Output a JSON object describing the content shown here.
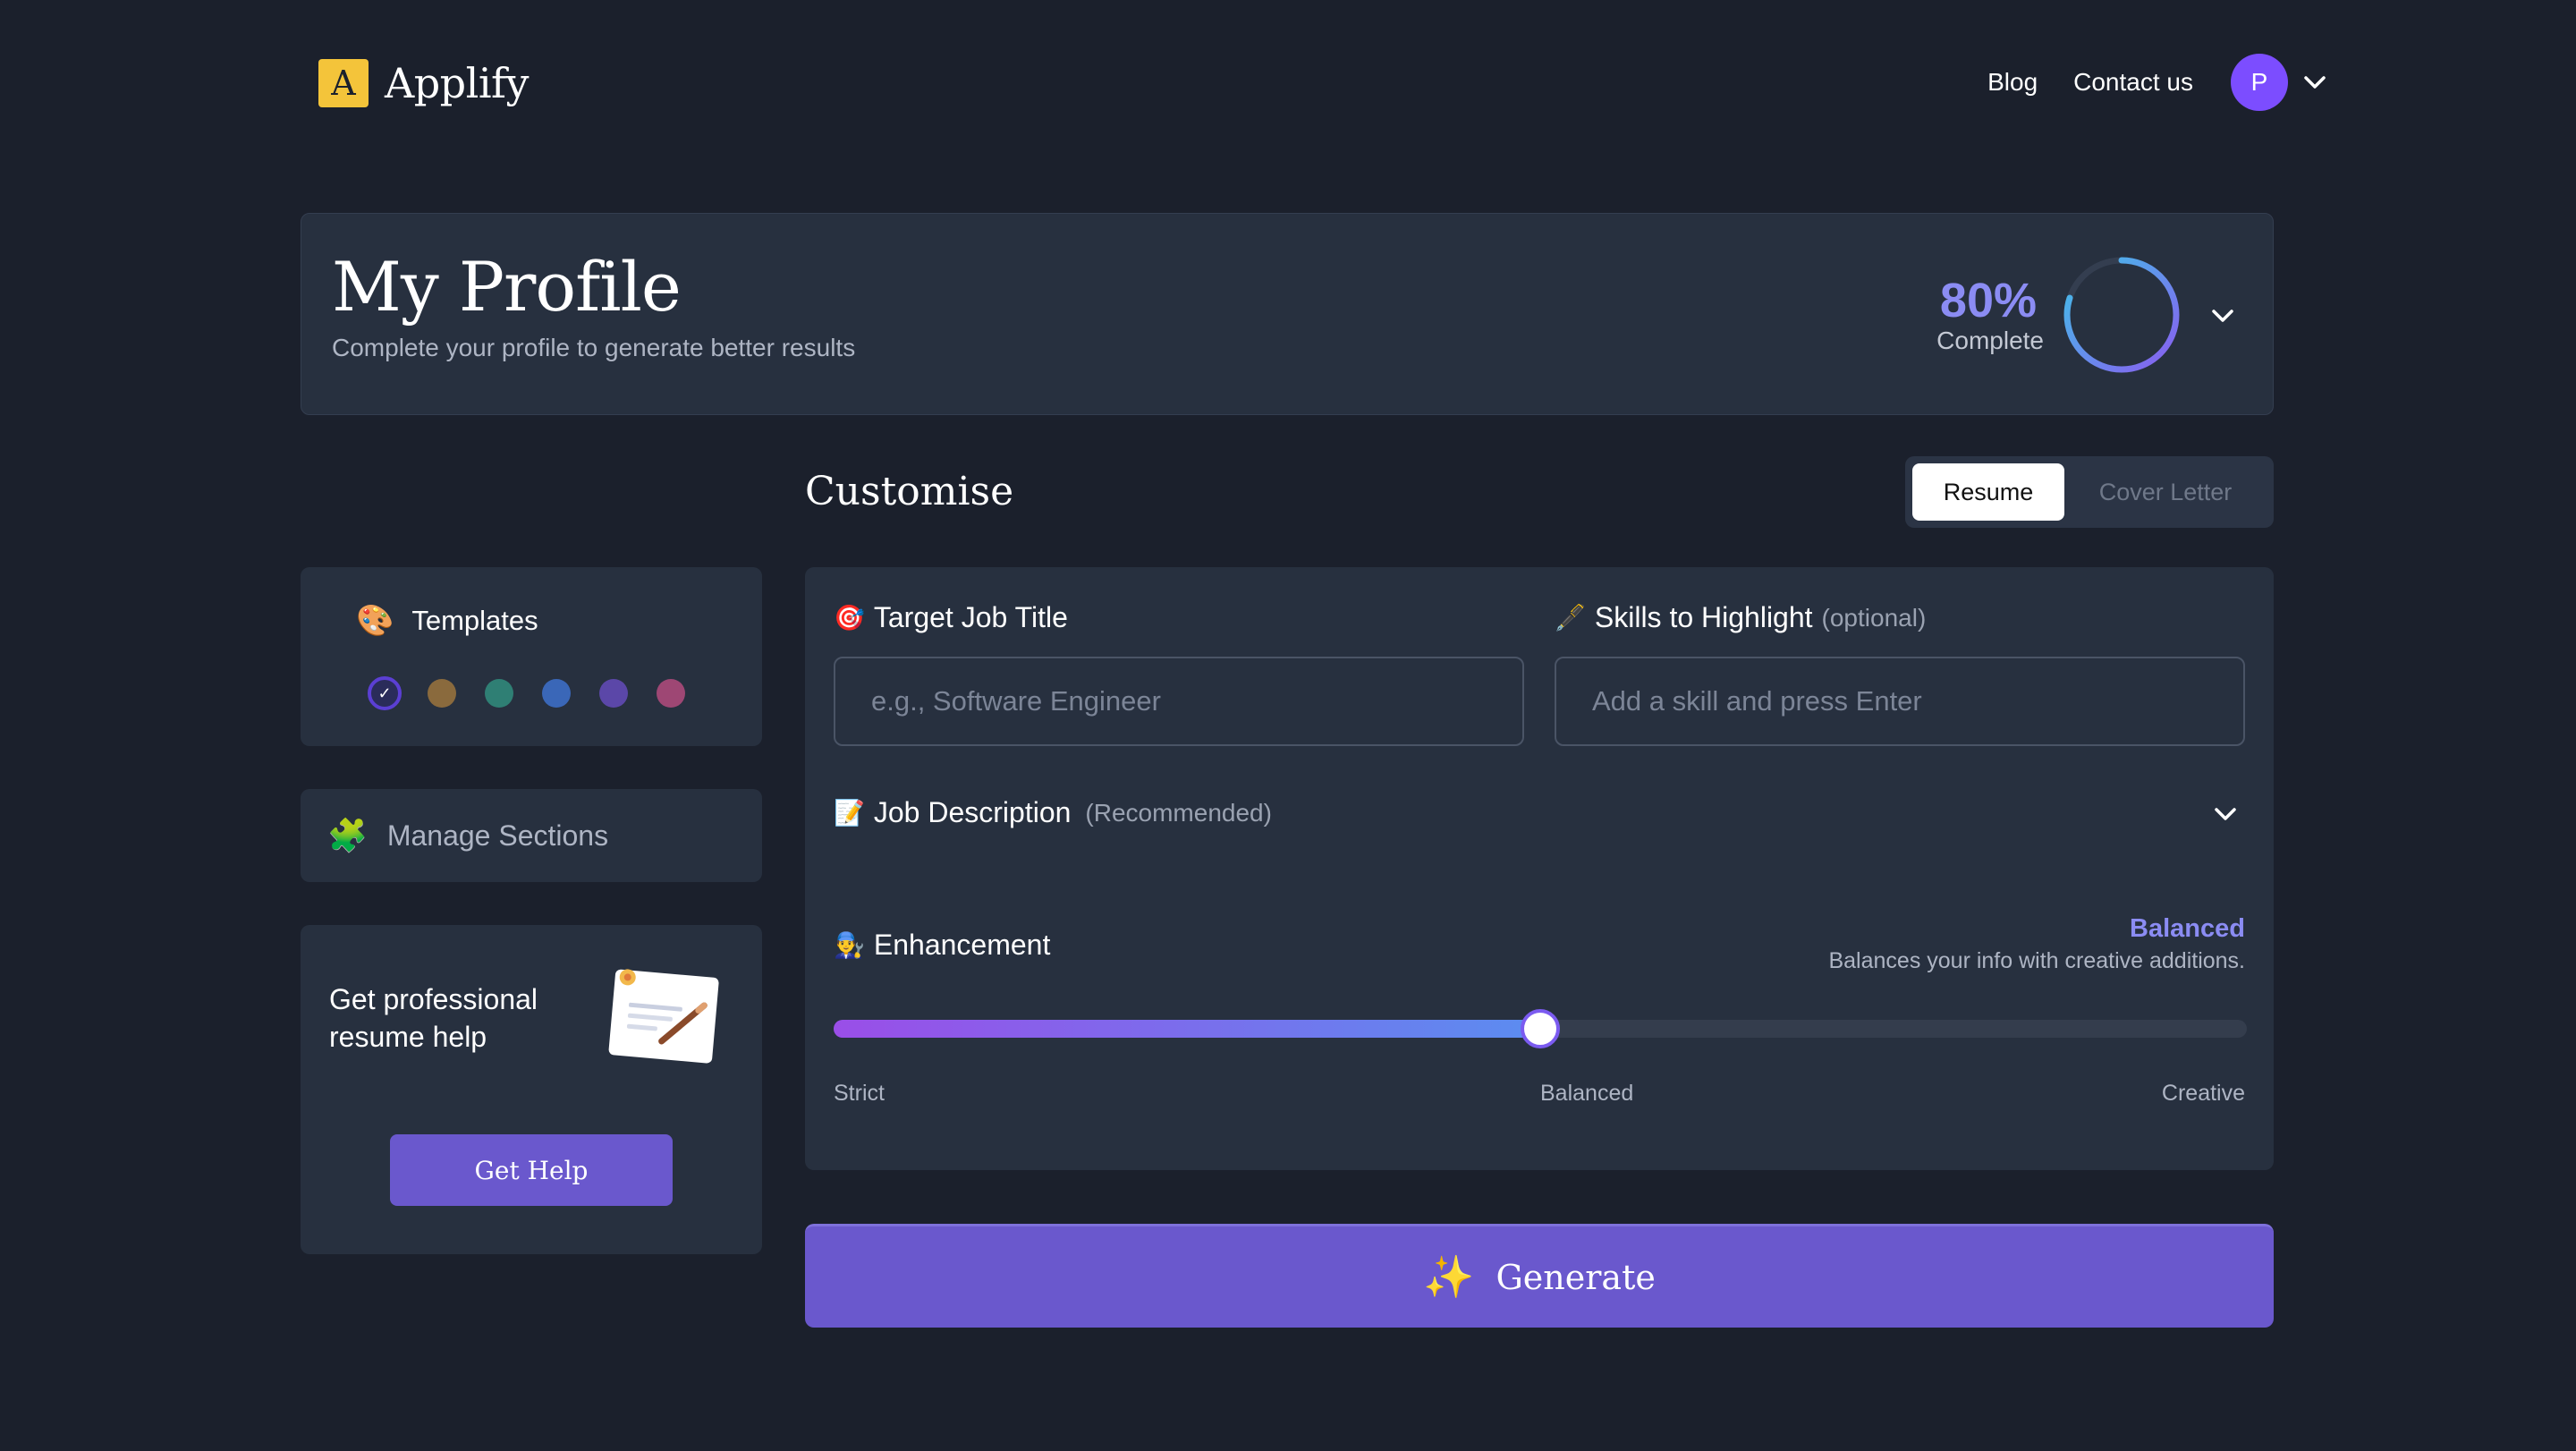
{
  "header": {
    "logo_letter": "A",
    "app_name": "Applify",
    "nav": {
      "blog": "Blog",
      "contact": "Contact us"
    },
    "avatar_initial": "P"
  },
  "profile": {
    "title": "My Profile",
    "subtitle": "Complete your profile to generate better results",
    "progress_percent": 80,
    "progress_text": "80%",
    "progress_label": "Complete"
  },
  "customise": {
    "title": "Customise",
    "tabs": [
      {
        "label": "Resume",
        "active": true
      },
      {
        "label": "Cover Letter",
        "active": false
      }
    ]
  },
  "sidebar": {
    "templates": {
      "emoji": "🎨",
      "label": "Templates",
      "colors": [
        "#5b3fd3",
        "#8a6a3d",
        "#2f7f74",
        "#3a67b8",
        "#5b47a8",
        "#9e4774"
      ],
      "selected_index": 0,
      "selected_mark": "✓"
    },
    "manage_sections": {
      "emoji": "🧩",
      "label": "Manage Sections"
    },
    "help": {
      "text": "Get professional resume help",
      "button": "Get Help"
    }
  },
  "form": {
    "job_title": {
      "emoji": "🎯",
      "label": "Target Job Title",
      "placeholder": "e.g., Software Engineer",
      "value": ""
    },
    "skills": {
      "emoji": "🖋️",
      "label": "Skills to Highlight",
      "note": "(optional)",
      "placeholder": "Add a skill and press Enter",
      "value": ""
    },
    "job_description": {
      "emoji": "📝",
      "label": "Job Description",
      "note": "(Recommended)"
    },
    "enhancement": {
      "emoji": "👨‍🔧",
      "label": "Enhancement",
      "value_label": "Balanced",
      "description": "Balances your info with creative additions.",
      "level": 0.5,
      "ticks": [
        "Strict",
        "Balanced",
        "Creative"
      ]
    }
  },
  "generate": {
    "emoji": "✨",
    "label": "Generate"
  },
  "colors": {
    "background": "#1b202c",
    "card": "#27303f",
    "accent": "#6a58cd",
    "accent_text": "#8b8cf3",
    "logo": "#f4c43a"
  }
}
